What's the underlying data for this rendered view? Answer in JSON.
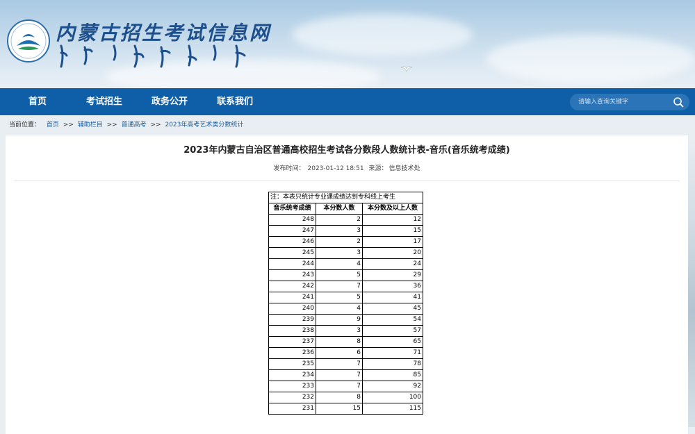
{
  "header": {
    "site_title": "内蒙古招生考试信息网",
    "colors": {
      "nav_bg": "#0f5fa8",
      "title": "#1d4f8c"
    }
  },
  "nav": {
    "items": [
      {
        "label": "首页"
      },
      {
        "label": "考试招生"
      },
      {
        "label": "政务公开"
      },
      {
        "label": "联系我们"
      }
    ],
    "search_placeholder": "请输入查询关键字"
  },
  "breadcrumb": {
    "prefix": "当前位置：",
    "items": [
      "首页",
      "辅助栏目",
      "普通高考",
      "2023年高考艺术类分数统计"
    ],
    "separator": ">>"
  },
  "article": {
    "title": "2023年内蒙古自治区普通高校招生考试各分数段人数统计表-音乐(音乐统考成绩)",
    "published_label": "发布时间：",
    "published_time": "2023-01-12 18:51",
    "source_label": "来源：",
    "source": "信息技术处"
  },
  "table": {
    "note": "注：本表只统计专业课成绩达到专科线上考生",
    "headers": [
      "音乐统考成绩",
      "本分数人数",
      "本分数及以上人数"
    ],
    "rows": [
      [
        "248",
        "2",
        "12"
      ],
      [
        "247",
        "3",
        "15"
      ],
      [
        "246",
        "2",
        "17"
      ],
      [
        "245",
        "3",
        "20"
      ],
      [
        "244",
        "4",
        "24"
      ],
      [
        "243",
        "5",
        "29"
      ],
      [
        "242",
        "7",
        "36"
      ],
      [
        "241",
        "5",
        "41"
      ],
      [
        "240",
        "4",
        "45"
      ],
      [
        "239",
        "9",
        "54"
      ],
      [
        "238",
        "3",
        "57"
      ],
      [
        "237",
        "8",
        "65"
      ],
      [
        "236",
        "6",
        "71"
      ],
      [
        "235",
        "7",
        "78"
      ],
      [
        "234",
        "7",
        "85"
      ],
      [
        "233",
        "7",
        "92"
      ],
      [
        "232",
        "8",
        "100"
      ],
      [
        "231",
        "15",
        "115"
      ]
    ]
  }
}
